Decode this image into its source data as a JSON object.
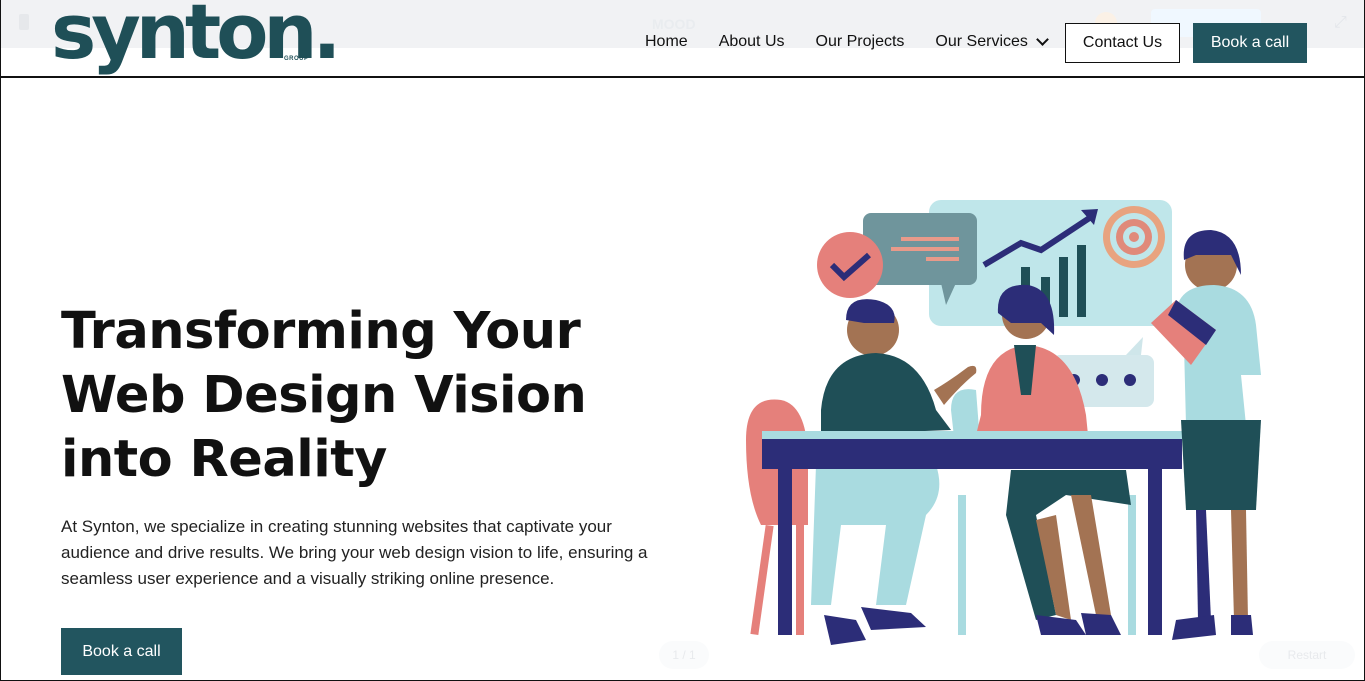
{
  "editor": {
    "mood_label": "MOOD",
    "page_counter": "1 / 1",
    "restart_label": "Restart"
  },
  "brand": {
    "logo_text": "synton.",
    "logo_subtext": "GROUP",
    "primary_color": "#22555f"
  },
  "nav": {
    "items": [
      {
        "label": "Home"
      },
      {
        "label": "About Us"
      },
      {
        "label": "Our Projects"
      },
      {
        "label": "Our Services"
      }
    ],
    "contact_label": "Contact Us",
    "book_label": "Book a call"
  },
  "hero": {
    "title": "Transforming Your Web Design Vision into Reality",
    "description": "At Synton, we specialize in creating stunning websites that captivate your audience and drive results. We bring your web design vision to life, ensuring a seamless user experience and a visually striking online presence.",
    "cta_label": "Book a call",
    "illustration_icon": "team-meeting-illustration"
  }
}
